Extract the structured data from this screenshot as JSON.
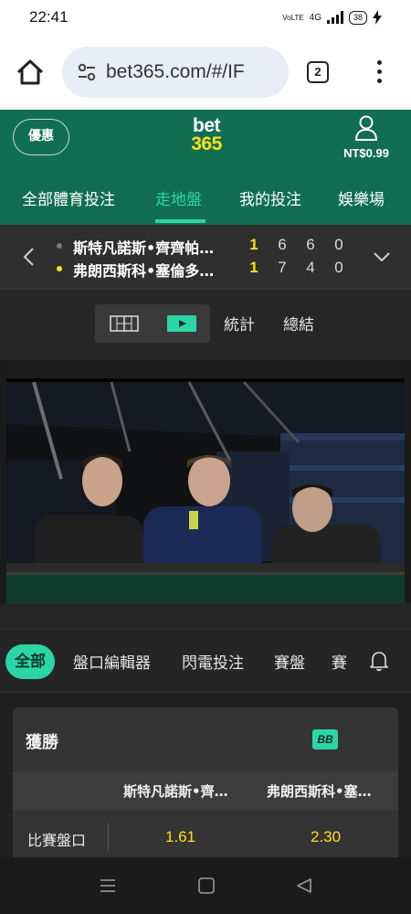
{
  "status_bar": {
    "time": "22:41",
    "network": "4G",
    "volte": "VoLTE",
    "battery": "38"
  },
  "browser": {
    "url": "bet365.com/#/IF",
    "tab_count": "2"
  },
  "header": {
    "promo_label": "優惠",
    "logo_top": "bet",
    "logo_bottom": "365",
    "balance": "NT$0.99",
    "nav": [
      "全部體育投注",
      "走地盤",
      "我的投注",
      "娛樂場"
    ],
    "active_nav": "走地盤"
  },
  "scoreboard": {
    "players": [
      {
        "name": "斯特凡諾斯•齊齊帕…",
        "serving": false,
        "sets": [
          "1",
          "6",
          "6",
          "0"
        ]
      },
      {
        "name": "弗朗西斯科•塞倫多…",
        "serving": true,
        "sets": [
          "1",
          "7",
          "4",
          "0"
        ]
      }
    ]
  },
  "view_tabs": {
    "stats": "統計",
    "summary": "總結"
  },
  "filter_tabs": [
    "全部",
    "盤口編輯器",
    "閃電投注",
    "賽盤",
    "賽"
  ],
  "market": {
    "title": "獲勝",
    "badge": "BB",
    "columns": [
      "斯特凡諾斯•齊…",
      "弗朗西斯科•塞…"
    ],
    "row_label": "比賽盤口",
    "odds": [
      "1.61",
      "2.30"
    ]
  },
  "colors": {
    "brand_green": "#126e51",
    "accent": "#2cd5a5",
    "odds_yellow": "#ffdf1b"
  }
}
